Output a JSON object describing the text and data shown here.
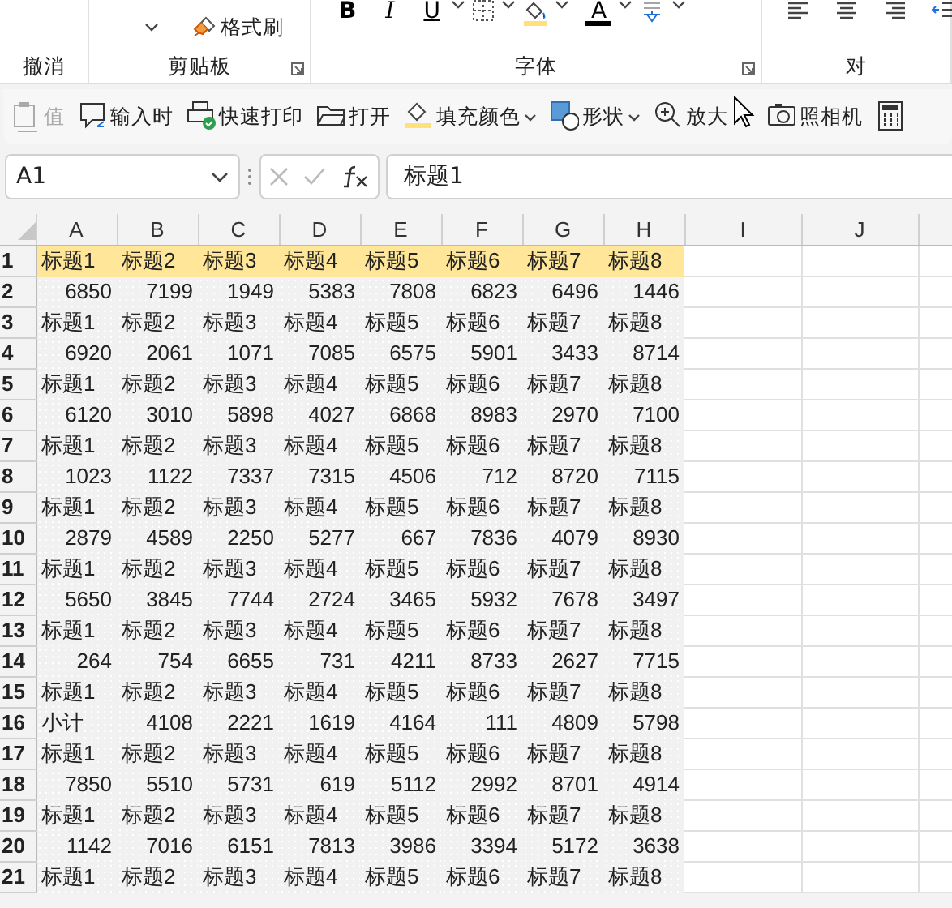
{
  "ribbon": {
    "clipboard": {
      "format_painter": "格式刷"
    },
    "font": {
      "bold": "B",
      "italic": "I",
      "underline": "U",
      "font_color": "A"
    },
    "groups": [
      {
        "label": "撤消",
        "launcher": false
      },
      {
        "label": "剪贴板",
        "launcher": true
      },
      {
        "label": "字体",
        "launcher": true
      },
      {
        "label": "对",
        "launcher": false
      }
    ]
  },
  "quick_toolbar": [
    {
      "kind": "paste-value",
      "label": "值",
      "disabled": true,
      "caret": false
    },
    {
      "kind": "comment",
      "label": "输入时",
      "disabled": false,
      "caret": false
    },
    {
      "kind": "print",
      "label": "快速打印",
      "disabled": false,
      "caret": false
    },
    {
      "kind": "folder",
      "label": "打开",
      "disabled": false,
      "caret": false
    },
    {
      "kind": "fill",
      "label": "填充颜色",
      "disabled": false,
      "caret": true
    },
    {
      "kind": "shape",
      "label": "形状",
      "disabled": false,
      "caret": true
    },
    {
      "kind": "zoom",
      "label": "放大",
      "disabled": false,
      "caret": false
    },
    {
      "kind": "camera",
      "label": "照相机",
      "disabled": false,
      "caret": false
    },
    {
      "kind": "calculator"
    }
  ],
  "formula_bar": {
    "name_box": "A1",
    "formula": "标题1"
  },
  "columns": [
    "A",
    "B",
    "C",
    "D",
    "E",
    "F",
    "G",
    "H",
    "I",
    "J"
  ],
  "rows": [
    {
      "number": "1",
      "highlighted": true,
      "cells": [
        "标题1",
        "标题2",
        "标题3",
        "标题4",
        "标题5",
        "标题6",
        "标题7",
        "标题8"
      ]
    },
    {
      "number": "2",
      "highlighted": false,
      "cells": [
        "6850",
        "7199",
        "1949",
        "5383",
        "7808",
        "6823",
        "6496",
        "1446"
      ]
    },
    {
      "number": "3",
      "highlighted": false,
      "cells": [
        "标题1",
        "标题2",
        "标题3",
        "标题4",
        "标题5",
        "标题6",
        "标题7",
        "标题8"
      ]
    },
    {
      "number": "4",
      "highlighted": false,
      "cells": [
        "6920",
        "2061",
        "1071",
        "7085",
        "6575",
        "5901",
        "3433",
        "8714"
      ]
    },
    {
      "number": "5",
      "highlighted": false,
      "cells": [
        "标题1",
        "标题2",
        "标题3",
        "标题4",
        "标题5",
        "标题6",
        "标题7",
        "标题8"
      ]
    },
    {
      "number": "6",
      "highlighted": false,
      "cells": [
        "6120",
        "3010",
        "5898",
        "4027",
        "6868",
        "8983",
        "2970",
        "7100"
      ]
    },
    {
      "number": "7",
      "highlighted": false,
      "cells": [
        "标题1",
        "标题2",
        "标题3",
        "标题4",
        "标题5",
        "标题6",
        "标题7",
        "标题8"
      ]
    },
    {
      "number": "8",
      "highlighted": false,
      "cells": [
        "1023",
        "1122",
        "7337",
        "7315",
        "4506",
        "712",
        "8720",
        "7115"
      ]
    },
    {
      "number": "9",
      "highlighted": false,
      "cells": [
        "标题1",
        "标题2",
        "标题3",
        "标题4",
        "标题5",
        "标题6",
        "标题7",
        "标题8"
      ]
    },
    {
      "number": "10",
      "highlighted": false,
      "cells": [
        "2879",
        "4589",
        "2250",
        "5277",
        "667",
        "7836",
        "4079",
        "8930"
      ]
    },
    {
      "number": "11",
      "highlighted": false,
      "cells": [
        "标题1",
        "标题2",
        "标题3",
        "标题4",
        "标题5",
        "标题6",
        "标题7",
        "标题8"
      ]
    },
    {
      "number": "12",
      "highlighted": false,
      "cells": [
        "5650",
        "3845",
        "7744",
        "2724",
        "3465",
        "5932",
        "7678",
        "3497"
      ]
    },
    {
      "number": "13",
      "highlighted": false,
      "cells": [
        "标题1",
        "标题2",
        "标题3",
        "标题4",
        "标题5",
        "标题6",
        "标题7",
        "标题8"
      ]
    },
    {
      "number": "14",
      "highlighted": false,
      "cells": [
        "264",
        "754",
        "6655",
        "731",
        "4211",
        "8733",
        "2627",
        "7715"
      ]
    },
    {
      "number": "15",
      "highlighted": false,
      "cells": [
        "标题1",
        "标题2",
        "标题3",
        "标题4",
        "标题5",
        "标题6",
        "标题7",
        "标题8"
      ]
    },
    {
      "number": "16",
      "highlighted": false,
      "cells": [
        "小计",
        "4108",
        "2221",
        "1619",
        "4164",
        "111",
        "4809",
        "5798"
      ]
    },
    {
      "number": "17",
      "highlighted": false,
      "cells": [
        "标题1",
        "标题2",
        "标题3",
        "标题4",
        "标题5",
        "标题6",
        "标题7",
        "标题8"
      ]
    },
    {
      "number": "18",
      "highlighted": false,
      "cells": [
        "7850",
        "5510",
        "5731",
        "619",
        "5112",
        "2992",
        "8701",
        "4914"
      ]
    },
    {
      "number": "19",
      "highlighted": false,
      "cells": [
        "标题1",
        "标题2",
        "标题3",
        "标题4",
        "标题5",
        "标题6",
        "标题7",
        "标题8"
      ]
    },
    {
      "number": "20",
      "highlighted": false,
      "cells": [
        "1142",
        "7016",
        "6151",
        "7813",
        "3986",
        "3394",
        "5172",
        "3638"
      ]
    },
    {
      "number": "21",
      "highlighted": false,
      "cells": [
        "标题1",
        "标题2",
        "标题3",
        "标题4",
        "标题5",
        "标题6",
        "标题7",
        "标题8"
      ]
    }
  ]
}
